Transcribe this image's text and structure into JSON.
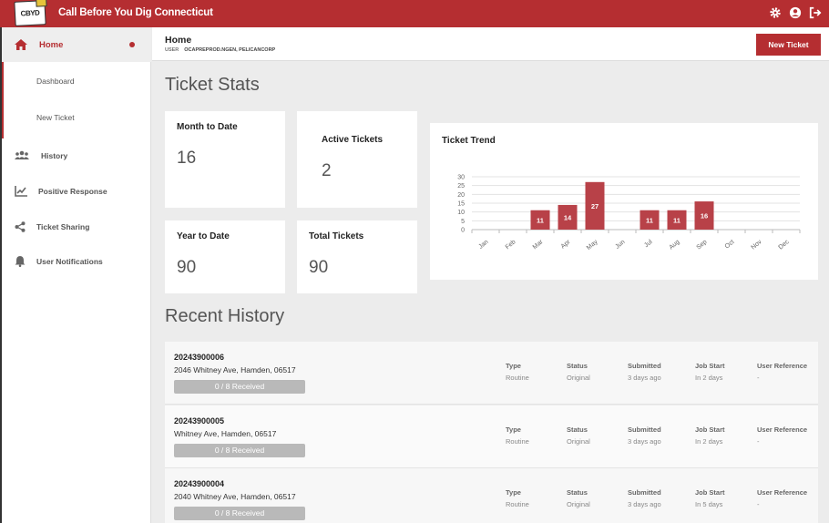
{
  "app": {
    "title": "Call Before You Dig Connecticut",
    "logo_text": "CBYD",
    "brand_color": "#b52e31"
  },
  "top_icons": [
    "gear-icon",
    "account-icon",
    "logout-icon"
  ],
  "sidebar": {
    "home": "Home",
    "sub_items": [
      "Dashboard",
      "New Ticket"
    ],
    "items": [
      {
        "label": "History",
        "icon": "users-icon"
      },
      {
        "label": "Positive Response",
        "icon": "chart-line-icon"
      },
      {
        "label": "Ticket Sharing",
        "icon": "share-icon"
      },
      {
        "label": "User Notifications",
        "icon": "bell-icon"
      }
    ]
  },
  "header": {
    "title": "Home",
    "user_key": "USER",
    "user_value": "OCAPREPROD.NGEN, PELICANCORP",
    "new_ticket": "New Ticket"
  },
  "stats": {
    "title": "Ticket Stats",
    "cards": [
      {
        "label": "Month to Date",
        "value": "16"
      },
      {
        "label": "Active Tickets",
        "value": "2"
      },
      {
        "label": "Year to Date",
        "value": "90"
      },
      {
        "label": "Total Tickets",
        "value": "90"
      }
    ]
  },
  "chart_title": "Ticket Trend",
  "chart_data": {
    "type": "bar",
    "title": "Ticket Trend",
    "categories": [
      "Jan",
      "Feb",
      "Mar",
      "Apr",
      "May",
      "Jun",
      "Jul",
      "Aug",
      "Sep",
      "Oct",
      "Nov",
      "Dec"
    ],
    "values": [
      0,
      0,
      11,
      14,
      27,
      0,
      11,
      11,
      16,
      0,
      0,
      0
    ],
    "ylim": [
      0,
      30
    ],
    "yticks": [
      0,
      5,
      10,
      15,
      20,
      25,
      30
    ],
    "grid": true,
    "color": "#b84148"
  },
  "history": {
    "title": "Recent History",
    "col_labels": {
      "type": "Type",
      "status": "Status",
      "submitted": "Submitted",
      "job_start": "Job Start",
      "user_ref": "User Reference"
    },
    "rows": [
      {
        "number": "20243900006",
        "address": "2046 Whitney Ave, Hamden, 06517",
        "received": "0 / 8 Received",
        "type": "Routine",
        "status": "Original",
        "submitted": "3 days ago",
        "job_start": "In 2 days",
        "user_ref": "-"
      },
      {
        "number": "20243900005",
        "address": "Whitney Ave, Hamden, 06517",
        "received": "0 / 8 Received",
        "type": "Routine",
        "status": "Original",
        "submitted": "3 days ago",
        "job_start": "In 2 days",
        "user_ref": "-"
      },
      {
        "number": "20243900004",
        "address": "2040 Whitney Ave, Hamden, 06517",
        "received": "0 / 8 Received",
        "type": "Routine",
        "status": "Original",
        "submitted": "3 days ago",
        "job_start": "In 5 days",
        "user_ref": "-"
      }
    ]
  }
}
